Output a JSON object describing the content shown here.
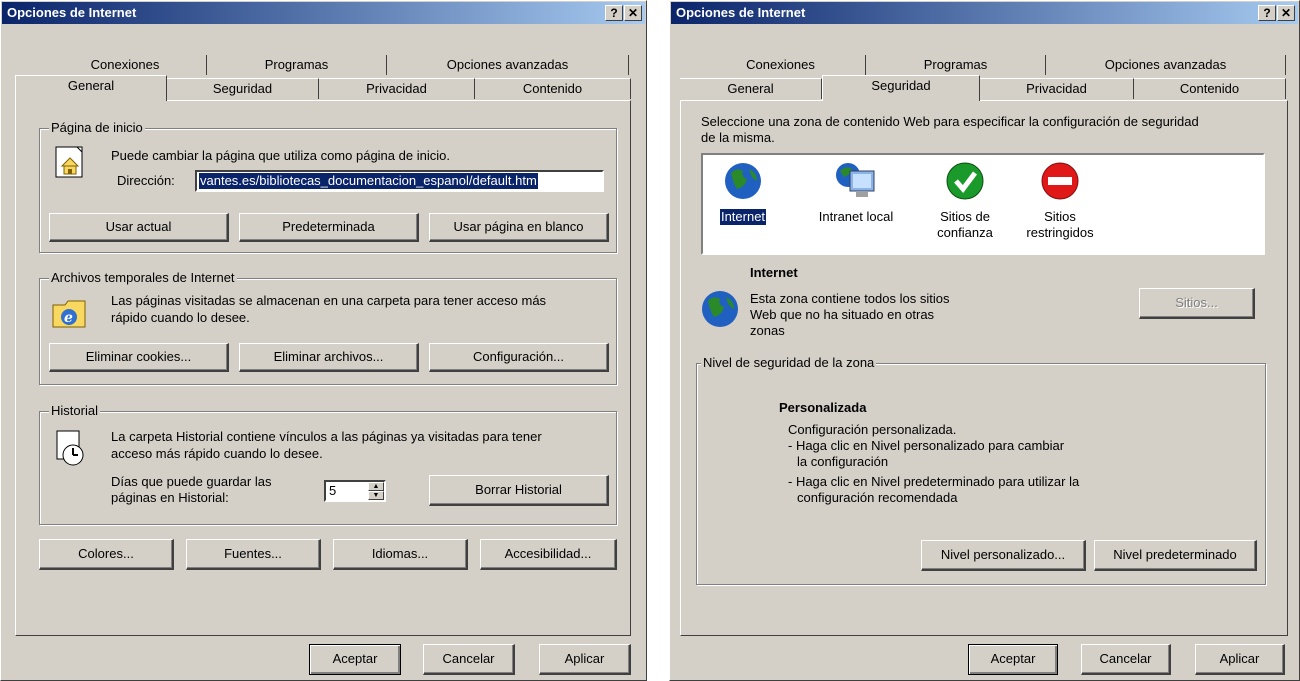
{
  "left": {
    "title": "Opciones de Internet",
    "tabs_row1": [
      "Conexiones",
      "Programas",
      "Opciones avanzadas"
    ],
    "tabs_row2": [
      "General",
      "Seguridad",
      "Privacidad",
      "Contenido"
    ],
    "homepage": {
      "group_title": "Página de inicio",
      "desc": "Puede cambiar la página que utiliza como página de inicio.",
      "address_label": "Dirección:",
      "address_value": "vantes.es/bibliotecas_documentacion_espanol/default.htm",
      "use_current": "Usar actual",
      "use_default": "Predeterminada",
      "use_blank": "Usar página en blanco"
    },
    "temp": {
      "group_title": "Archivos temporales de Internet",
      "desc1": "Las páginas visitadas se almacenan en una carpeta para tener acceso más",
      "desc2": "rápido cuando lo desee.",
      "delete_cookies": "Eliminar cookies...",
      "delete_files": "Eliminar archivos...",
      "settings": "Configuración..."
    },
    "history": {
      "group_title": "Historial",
      "desc1": "La carpeta Historial contiene vínculos a las páginas ya visitadas para tener",
      "desc2": "acceso más rápido cuando lo desee.",
      "days_label1": "Días que puede guardar las",
      "days_label2": "páginas en Historial:",
      "days_value": "5",
      "clear": "Borrar Historial"
    },
    "bottom": {
      "colors": "Colores...",
      "fonts": "Fuentes...",
      "languages": "Idiomas...",
      "accessibility": "Accesibilidad..."
    },
    "ok": "Aceptar",
    "cancel": "Cancelar",
    "apply": "Aplicar"
  },
  "right": {
    "title": "Opciones de Internet",
    "tabs_row1": [
      "Conexiones",
      "Programas",
      "Opciones avanzadas"
    ],
    "tabs_row2": [
      "General",
      "Seguridad",
      "Privacidad",
      "Contenido"
    ],
    "intro1": "Seleccione una zona de contenido Web para especificar la configuración de seguridad",
    "intro2": "de la misma.",
    "zones": [
      {
        "l1": "Internet",
        "l2": ""
      },
      {
        "l1": "Intranet local",
        "l2": ""
      },
      {
        "l1": "Sitios de",
        "l2": "confianza"
      },
      {
        "l1": "Sitios",
        "l2": "restringidos"
      }
    ],
    "zone_title": "Internet",
    "zone_desc1": "Esta zona contiene todos los sitios",
    "zone_desc2": "Web que no ha situado en otras",
    "zone_desc3": "zonas",
    "sites": "Sitios...",
    "level_group": "Nivel de seguridad de la zona",
    "level_title": "Personalizada",
    "level_l1": "Configuración personalizada.",
    "level_l2": "- Haga clic en Nivel personalizado para cambiar",
    "level_l3": "la configuración",
    "level_l4": "- Haga clic en Nivel predeterminado para utilizar la",
    "level_l5": "configuración recomendada",
    "custom_level": "Nivel personalizado...",
    "default_level": "Nivel predeterminado",
    "ok": "Aceptar",
    "cancel": "Cancelar",
    "apply": "Aplicar"
  },
  "colors": {
    "title_start": "#0a246a",
    "title_end": "#a6caf0",
    "face": "#d4d0c8",
    "selection": "#0a246a"
  },
  "icons": [
    "help-icon",
    "close-icon",
    "home-page-icon",
    "temp-files-icon",
    "history-icon",
    "internet-globe-icon",
    "intranet-icon",
    "trusted-sites-icon",
    "restricted-sites-icon"
  ]
}
